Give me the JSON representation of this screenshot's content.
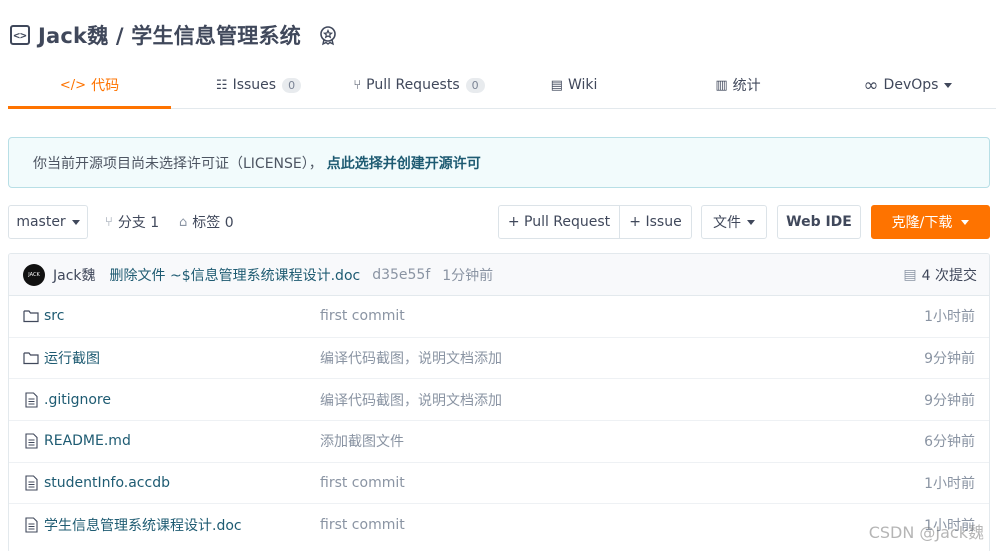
{
  "repo": {
    "title": "Jack魏 / 学生信息管理系统"
  },
  "tabs": [
    {
      "icon": "</>",
      "label": "代码",
      "count": ""
    },
    {
      "icon": "☷",
      "label": "Issues",
      "count": "0"
    },
    {
      "icon": "⑂",
      "label": "Pull Requests",
      "count": "0"
    },
    {
      "icon": "▤",
      "label": "Wiki",
      "count": ""
    },
    {
      "icon": "▥",
      "label": "统计",
      "count": ""
    },
    {
      "icon": "∞",
      "label": "DevOps",
      "count": ""
    }
  ],
  "notice": {
    "text": "你当前开源项目尚未选择许可证（LICENSE），",
    "link": "点此选择并创建开源许可"
  },
  "toolbar": {
    "branch": "master",
    "branches_label": "分支 1",
    "tags_label": "标签 0",
    "pull_request": "+ Pull Request",
    "issue": "+ Issue",
    "files": "文件",
    "web_ide": "Web IDE",
    "clone": "克隆/下载"
  },
  "commit": {
    "author": "Jack魏",
    "message": "删除文件 ~$信息管理系统课程设计.doc",
    "sha": "d35e55f",
    "time": "1分钟前",
    "count": "4 次提交"
  },
  "files": [
    {
      "type": "folder",
      "name": "src",
      "commit": "first commit",
      "time": "1小时前"
    },
    {
      "type": "folder",
      "name": "运行截图",
      "commit": "编译代码截图，说明文档添加",
      "time": "9分钟前"
    },
    {
      "type": "file",
      "name": ".gitignore",
      "commit": "编译代码截图，说明文档添加",
      "time": "9分钟前"
    },
    {
      "type": "file",
      "name": "README.md",
      "commit": "添加截图文件",
      "time": "6分钟前"
    },
    {
      "type": "file",
      "name": "studentInfo.accdb",
      "commit": "first commit",
      "time": "1小时前"
    },
    {
      "type": "file",
      "name": "学生信息管理系统课程设计.doc",
      "commit": "first commit",
      "time": "1小时前"
    }
  ],
  "watermark": "CSDN @Jack魏",
  "colors": {
    "accent": "#fe7300",
    "link": "#1e5b72",
    "notice_bg": "#f2fbfc"
  }
}
